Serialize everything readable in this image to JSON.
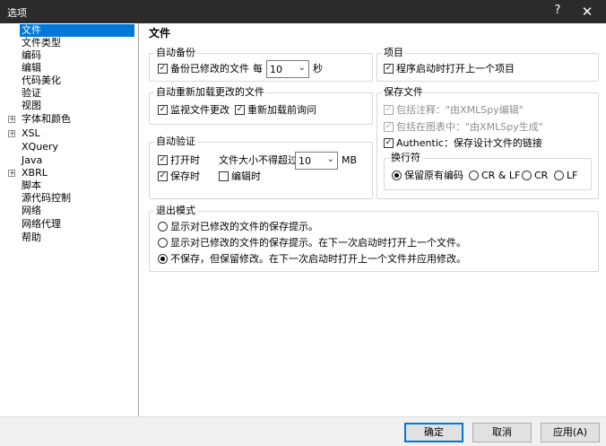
{
  "window": {
    "title": "选项",
    "help": "?",
    "close": "✕"
  },
  "tree": [
    {
      "label": "文件",
      "selected": true,
      "expandable": false
    },
    {
      "label": "文件类型",
      "expandable": false
    },
    {
      "label": "编码",
      "expandable": false
    },
    {
      "label": "编辑",
      "expandable": false
    },
    {
      "label": "代码美化",
      "expandable": false
    },
    {
      "label": "验证",
      "expandable": false
    },
    {
      "label": "视图",
      "expandable": false
    },
    {
      "label": "字体和颜色",
      "expandable": true
    },
    {
      "label": "XSL",
      "expandable": true
    },
    {
      "label": "XQuery",
      "expandable": false
    },
    {
      "label": "Java",
      "expandable": false
    },
    {
      "label": "XBRL",
      "expandable": true
    },
    {
      "label": "脚本",
      "expandable": false
    },
    {
      "label": "源代码控制",
      "expandable": false
    },
    {
      "label": "网络",
      "expandable": false
    },
    {
      "label": "网络代理",
      "expandable": false
    },
    {
      "label": "帮助",
      "expandable": false
    }
  ],
  "page_title": "文件",
  "autosave": {
    "label": "自动备份",
    "backup_label": "备份已修改的文件",
    "every_label": "每",
    "interval_value": "10",
    "unit": "秒"
  },
  "reload": {
    "label": "自动重新加载更改的文件",
    "monitor_label": "监视文件更改",
    "ask_label": "重新加载前询问"
  },
  "validation": {
    "label": "自动验证",
    "on_open_label": "打开时",
    "size_label": "文件大小不得超过",
    "size_value": "10",
    "size_unit": "MB",
    "on_save_label": "保存时",
    "on_edit_label": "编辑时"
  },
  "project": {
    "label": "项目",
    "open_last_label": "程序启动时打开上一个项目"
  },
  "save_file": {
    "label": "保存文件",
    "include_comment_label": "包括注释：\"由XMLSpy编辑\"",
    "include_chart_label": "包括在图表中：\"由XMLSpy生成\"",
    "authentic_label": "Authentic：保存设计文件的链接"
  },
  "line_break": {
    "label": "换行符",
    "options": [
      "保留原有编码",
      "CR & LF",
      "CR",
      "LF"
    ]
  },
  "exit_mode": {
    "label": "退出模式",
    "options": [
      "显示对已修改的文件的保存提示。",
      "显示对已修改的文件的保存提示。在下一次启动时打开上一个文件。",
      "不保存，但保留修改。在下一次启动时打开上一个文件并应用修改。"
    ]
  },
  "buttons": {
    "ok": "确定",
    "cancel": "取消",
    "apply": "应用(A)"
  },
  "icons": {
    "checkbox": "checkbox-icon",
    "radio": "radio-icon",
    "dropdown": "chevron-down-icon",
    "expander": "plus-icon"
  },
  "colors": {
    "accent": "#0078d7",
    "titlebar": "#2b2b2b"
  }
}
